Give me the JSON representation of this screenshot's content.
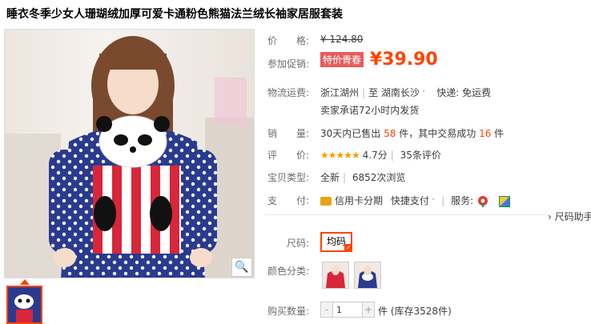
{
  "product": {
    "title": "睡衣冬季少女人珊瑚绒加厚可爱卡通粉色熊猫法兰绒长袖家居服套装"
  },
  "price": {
    "label": "价　　格:",
    "original": "¥ 124.80",
    "promo_label": "参加促销:",
    "promo_tag": "特价青春",
    "currency": "¥",
    "promo_price": "39.90"
  },
  "shipping": {
    "label": "物流运费:",
    "from": "浙江湖州",
    "to_prefix": "至",
    "to": "湖南长沙",
    "caret": "˅",
    "fee": "快递: 免运费",
    "promise": "卖家承诺72小时内发货"
  },
  "sales": {
    "label": "销　　量:",
    "prefix": "30天内已售出",
    "sold": "58",
    "unit1": "件，其中交易成功",
    "success": "16",
    "unit2": "件"
  },
  "rating": {
    "label": "评　　价:",
    "stars": "★★★★★",
    "score": "4.7分",
    "reviews": "35条评价"
  },
  "item_type": {
    "label": "宝贝类型:",
    "value": "全新",
    "views": "6852次浏览"
  },
  "payment": {
    "label": "支　　付:",
    "credit": "信用卡分期",
    "quick": "快捷支付",
    "service_label": "服务:"
  },
  "size_helper": "› 尺码助手",
  "size": {
    "label": "尺码:",
    "option": "均码",
    "check": "✓"
  },
  "color": {
    "label": "颜色分类:"
  },
  "quantity": {
    "label": "购买数量:",
    "minus": "-",
    "value": "1",
    "plus": "+",
    "unit": "件",
    "stock": "(库存3528件)"
  },
  "zoom_icon": "magnifier-icon",
  "colors": {
    "accent": "#ff4400",
    "promo_tag_bg": "#e85b5b",
    "star": "#f4a000"
  }
}
